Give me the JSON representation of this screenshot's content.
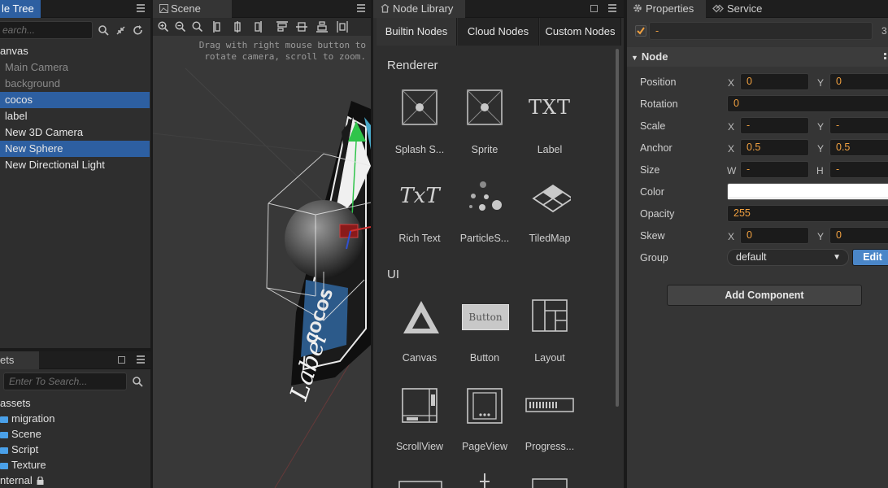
{
  "node_tree": {
    "tab": "le Tree",
    "items": [
      {
        "label": "anvas"
      },
      {
        "label": "Main Camera"
      },
      {
        "label": "background"
      },
      {
        "label": "cocos"
      },
      {
        "label": "label"
      },
      {
        "label": "New 3D Camera"
      },
      {
        "label": "New Sphere"
      },
      {
        "label": "New Directional Light"
      }
    ]
  },
  "assets": {
    "tab": "ets",
    "search_placeholder": "Enter To Search...",
    "items": [
      {
        "label": "assets"
      },
      {
        "label": "migration"
      },
      {
        "label": "Scene"
      },
      {
        "label": "Script"
      },
      {
        "label": "Texture"
      },
      {
        "label": "nternal"
      }
    ]
  },
  "top_left": {
    "search_placeholder": "earch..."
  },
  "scene": {
    "tab": "Scene",
    "hint_line1": "Drag with right mouse button to",
    "hint_line2": "rotate camera, scroll to zoom.",
    "label_text": "Label",
    "logo_text": "COCOS"
  },
  "node_library": {
    "tab": "Node Library",
    "tabs": [
      "Builtin Nodes",
      "Cloud Nodes",
      "Custom Nodes"
    ],
    "sections": {
      "renderer": "Renderer",
      "ui": "UI"
    },
    "renderer_items": [
      "Splash S...",
      "Sprite",
      "Label",
      "Rich Text",
      "ParticleS...",
      "TiledMap"
    ],
    "ui_items": [
      "Canvas",
      "Button",
      "Layout",
      "ScrollView",
      "PageView",
      "Progress..."
    ],
    "icon_text": {
      "label": "TXT",
      "rich_text": "TxT",
      "button": "Button"
    }
  },
  "properties": {
    "tab": "Properties",
    "service_tab": "Service",
    "name_value": "-",
    "name_suffix": "3",
    "node_header": "Node",
    "rows": {
      "position": {
        "label": "Position",
        "ax1": "X",
        "v1": "0",
        "ax2": "Y",
        "v2": "0"
      },
      "rotation": {
        "label": "Rotation",
        "v1": "0"
      },
      "scale": {
        "label": "Scale",
        "ax1": "X",
        "v1": "-",
        "ax2": "Y",
        "v2": "-"
      },
      "anchor": {
        "label": "Anchor",
        "ax1": "X",
        "v1": "0.5",
        "ax2": "Y",
        "v2": "0.5"
      },
      "size": {
        "label": "Size",
        "ax1": "W",
        "v1": "-",
        "ax2": "H",
        "v2": "-"
      },
      "color": {
        "label": "Color",
        "value": "#ffffff"
      },
      "opacity": {
        "label": "Opacity",
        "v1": "255"
      },
      "skew": {
        "label": "Skew",
        "ax1": "X",
        "v1": "0",
        "ax2": "Y",
        "v2": "0"
      },
      "group": {
        "label": "Group",
        "value": "default",
        "edit": "Edit"
      }
    },
    "add_component": "Add Component"
  },
  "colors": {
    "selection": "#2d5fa1",
    "value_orange": "#f0a040",
    "edit_blue": "#4a86c8",
    "folder_blue": "#4aa0e8"
  }
}
